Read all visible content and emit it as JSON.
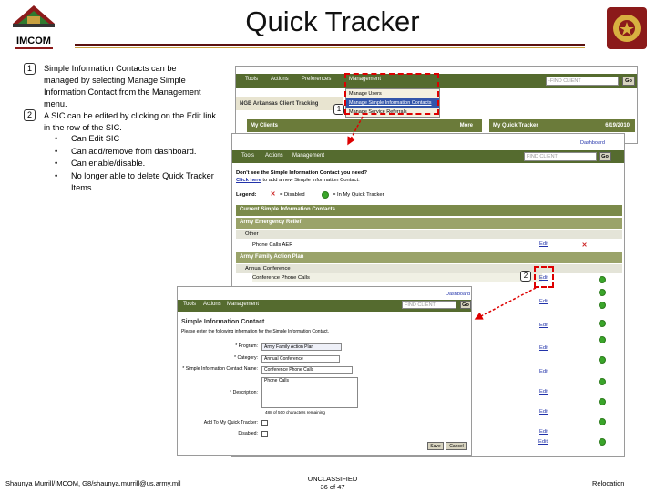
{
  "slide": {
    "title": "Quick Tracker",
    "logo_text": "IMCOM"
  },
  "bullets": [
    {
      "num": "1",
      "text": "Simple Information Contacts can be managed by selecting Manage Simple Information Contact from the Management menu."
    },
    {
      "num": "2",
      "text": "A SIC can be edited by clicking on the Edit link in the row of the SIC."
    }
  ],
  "sub_bullets": [
    "Can Edit SIC",
    "Can add/remove from dashboard.",
    "Can enable/disable.",
    "No longer able to delete Quick Tracker Items"
  ],
  "footer": {
    "left": "Shaunya Murrill/IMCOM, G8/shaunya.murrill@us.army.mil",
    "classification": "UNCLASSIFIED",
    "page": "36 of 47",
    "right": "Relocation"
  },
  "shot1": {
    "menu": [
      "Tools",
      "Actions",
      "Preferences",
      "Management"
    ],
    "search_placeholder": "-FIND CLIENT",
    "go": "Go",
    "client_bar": "NGB Arkansas Client Tracking",
    "my_clients": "My Clients",
    "more": "More",
    "quick_tracker": "My Quick Tracker",
    "date": "6/19/2010",
    "dropdown_items": [
      "Manage Users",
      "Manage Simple Information Contacts",
      "Manage Service Referrals"
    ],
    "anno": "1"
  },
  "shot2": {
    "menu": [
      "Tools",
      "Actions",
      "Management"
    ],
    "search_placeholder": "FIND CLIENT",
    "go": "Go",
    "dashboard": "Dashboard",
    "prompt_line1": "Don't see the Simple Information Contact you need?",
    "prompt_link": "Click here",
    "prompt_line2": "to add a new Simple Information Contact.",
    "legend": "Legend:",
    "legend_disabled": "= Disabled",
    "legend_quick": "= In My Quick Tracker",
    "section": "Current Simple Information Contacts",
    "groups": [
      {
        "name": "Army Emergency Relief",
        "sub": "Other",
        "row": "Phone Calls AER"
      },
      {
        "name": "Army Family Action Plan",
        "sub": "Annual Conference",
        "row": "Conference Phone Calls"
      }
    ],
    "edit": "Edit",
    "anno": "2"
  },
  "shot3": {
    "menu": [
      "Tools",
      "Actions",
      "Management"
    ],
    "search_placeholder": "FIND CLIENT",
    "go": "Go",
    "dashboard": "Dashboard",
    "heading": "Simple Information Contact",
    "instructions": "Please enter the following information for the Simple Information Contact.",
    "fields": {
      "program_label": "* Program:",
      "program_value": "Army Family Action Plan",
      "category_label": "* Category:",
      "category_value": "Annual Conference",
      "name_label": "* Simple Information Contact Name:",
      "name_value": "Conference Phone Calls",
      "description_label": "* Description:",
      "description_value": "Phone Calls",
      "chars_remaining": "488 of 500 characters remaining",
      "quick_label": "Add To My Quick Tracker:",
      "disabled_label": "Disabled:"
    },
    "save": "Save",
    "cancel": "Cancel",
    "edit": "Edit"
  },
  "colors": {
    "menu_olive": "#556b2f",
    "annotation_red": "#dd0000",
    "title_rule": "#5a1010"
  }
}
